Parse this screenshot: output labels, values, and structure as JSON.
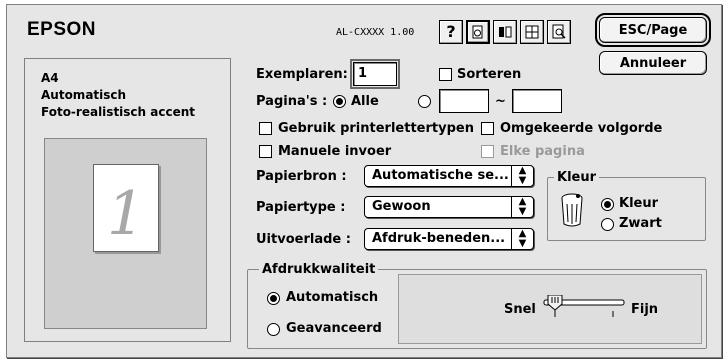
{
  "header": {
    "logo": "EPSON",
    "model": "AL-CXXXX 1.00",
    "toolbar_icons": [
      "help-icon",
      "page-setup-icon",
      "utility-icon",
      "layout-icon",
      "preview-icon"
    ],
    "help_glyph": "?",
    "esc_page": "ESC/Page",
    "cancel": "Annuleer"
  },
  "summary": {
    "paper": "A4",
    "mode": "Automatisch",
    "quality": "Foto-realistisch accent",
    "preview_number": "1"
  },
  "copies": {
    "label": "Exemplaren:",
    "value": "1",
    "collate_label": "Sorteren",
    "collate_checked": false
  },
  "pages": {
    "label": "Pagina's :",
    "all_label": "Alle",
    "all_selected": true,
    "from": "",
    "separator": "~",
    "to": ""
  },
  "options": {
    "printer_fonts": "Gebruik printerlettertypen",
    "reverse_order": "Omgekeerde volgorde",
    "manual_feed": "Manuele invoer",
    "each_page": "Elke pagina"
  },
  "paper_source": {
    "label": "Papierbron :",
    "value": "Automatische se..."
  },
  "paper_type": {
    "label": "Papiertype :",
    "value": "Gewoon"
  },
  "output_tray": {
    "label": "Uitvoerlade :",
    "value": "Afdruk-beneden..."
  },
  "color": {
    "group_title": "Kleur",
    "color_label": "Kleur",
    "black_label": "Zwart",
    "selected": "Kleur"
  },
  "quality": {
    "group_title": "Afdrukkwaliteit",
    "automatic_label": "Automatisch",
    "advanced_label": "Geavanceerd",
    "selected": "Automatisch",
    "slider_left": "Snel",
    "slider_right": "Fijn",
    "slider_level": 0
  }
}
